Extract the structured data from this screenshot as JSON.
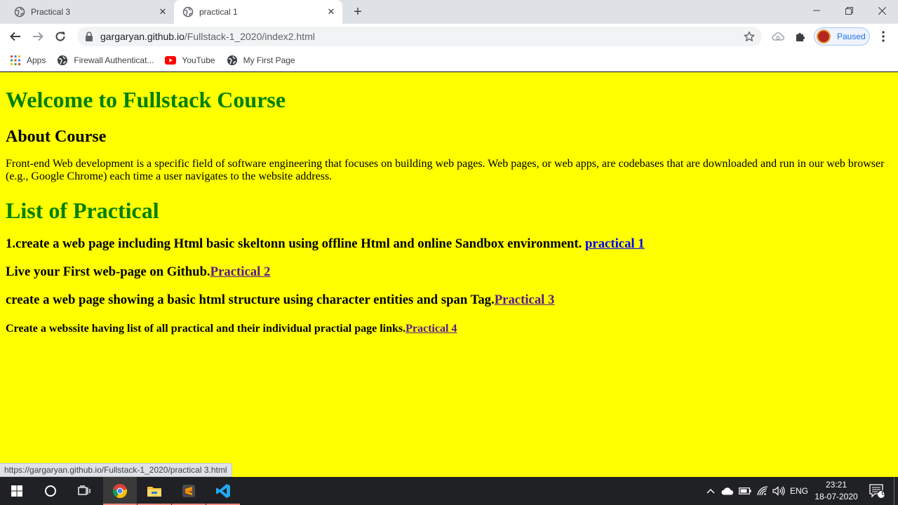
{
  "browser": {
    "tabs": [
      {
        "title": "Practical 3",
        "active": false
      },
      {
        "title": "practical 1",
        "active": true
      }
    ],
    "new_tab_label": "+",
    "omnibox": {
      "domain": "gargaryan.github.io",
      "path": "/Fullstack-1_2020/index2.html"
    },
    "profile_label": "Paused",
    "bookmarks": [
      {
        "label": "Apps",
        "icon": "apps-grid-icon"
      },
      {
        "label": "Firewall Authenticat...",
        "icon": "globe-icon"
      },
      {
        "label": "YouTube",
        "icon": "youtube-icon"
      },
      {
        "label": "My First Page",
        "icon": "globe-icon"
      }
    ],
    "status_url": "https://gargaryan.github.io/Fullstack-1_2020/practical 3.html"
  },
  "page": {
    "background": "#ffff00",
    "heading_color": "#008000",
    "title": "Welcome to Fullstack Course",
    "about_heading": "About Course",
    "about_text": "Front-end Web development is a specific field of software engineering that focuses on building web pages. Web pages, or web apps, are codebases that are downloaded and run in our web browser (e.g., Google Chrome) each time a user navigates to the website address.",
    "list_heading": "List of Practical",
    "practicals": [
      {
        "text": "1.create a web page including Html basic skeltonn using offline Html and online Sandbox environment. ",
        "link": "practical 1"
      },
      {
        "text": "Live your First web-page on Github.",
        "link": "Practical 2"
      },
      {
        "text": "create a web page showing a basic html structure using character entities and span Tag.",
        "link": "Practical 3"
      },
      {
        "text": "Create a webssite having list of all practical and their individual practial page links.",
        "link": "Practical 4"
      }
    ]
  },
  "taskbar": {
    "language": "ENG",
    "time": "23:21",
    "date": "18-07-2020",
    "notification_count": "6"
  }
}
